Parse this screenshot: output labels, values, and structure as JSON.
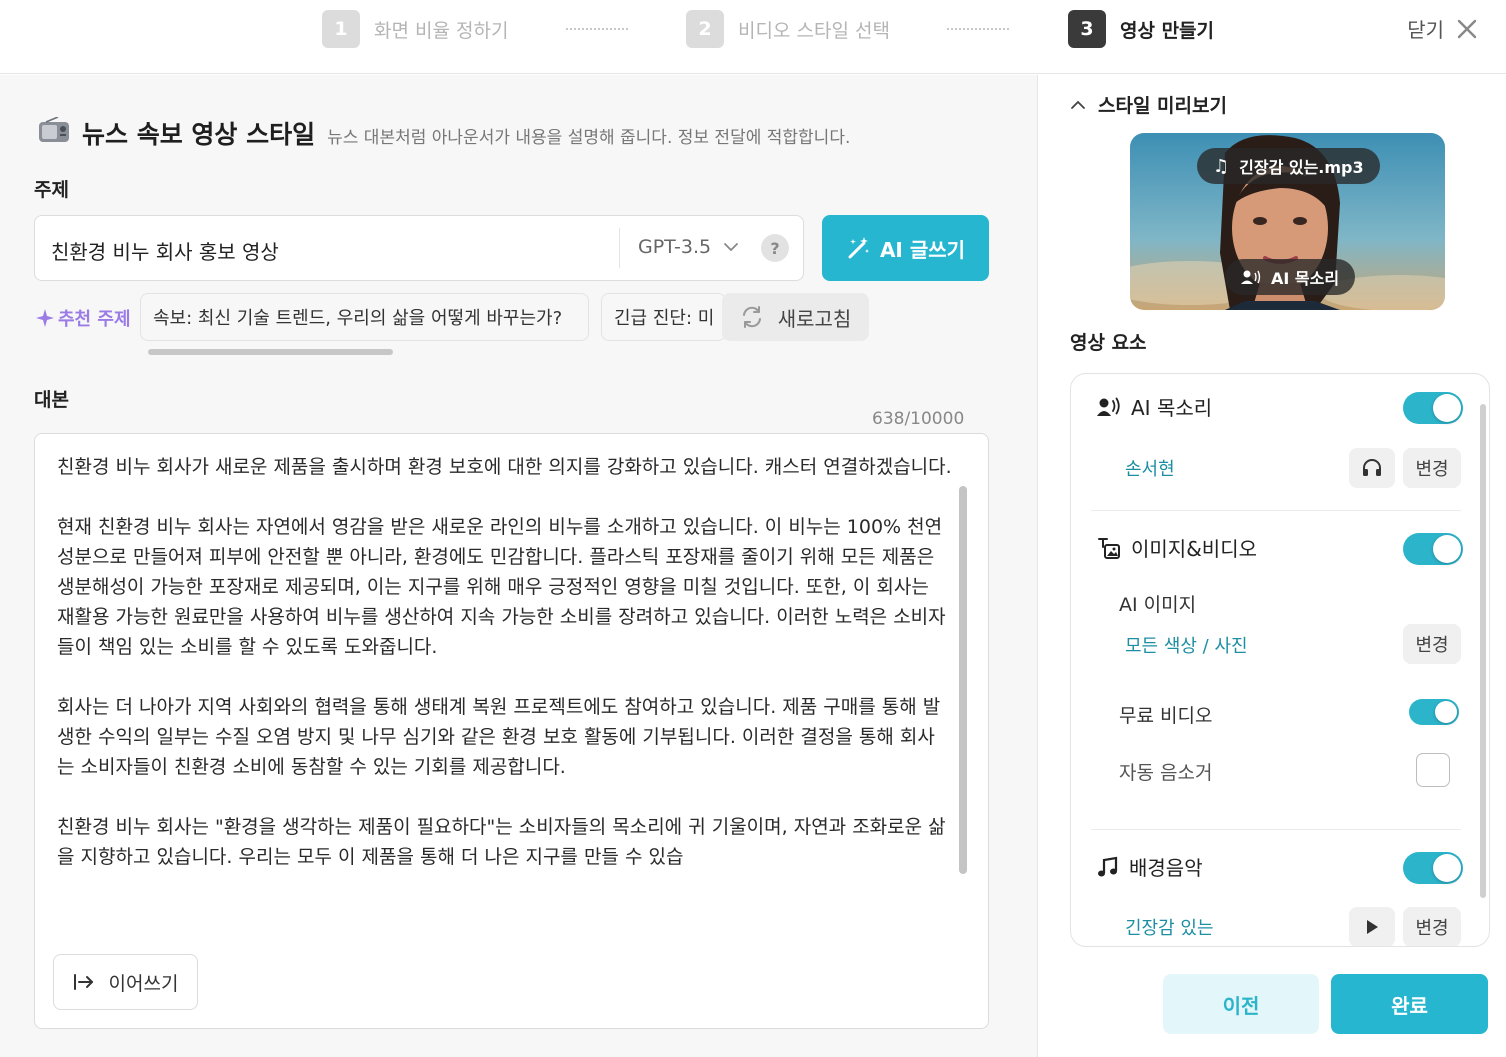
{
  "stepper": {
    "steps": [
      {
        "num": "1",
        "label": "화면 비율 정하기"
      },
      {
        "num": "2",
        "label": "비디오 스타일 선택"
      },
      {
        "num": "3",
        "label": "영상 만들기"
      }
    ],
    "close_label": "닫기",
    "active_step": 3
  },
  "style": {
    "title": "뉴스 속보 영상 스타일",
    "description": "뉴스 대본처럼 아나운서가 내용을 설명해 줍니다. 정보 전달에 적합합니다.",
    "icon": "radio-icon"
  },
  "topic": {
    "label": "주제",
    "value": "친환경 비누 회사 홍보 영상",
    "model": "GPT-3.5",
    "help": "?",
    "ai_write_label": "AI 글쓰기"
  },
  "recommend": {
    "label": "추천 주제",
    "chips": [
      "속보: 최신 기술 트렌드, 우리의 삶을 어떻게 바꾸는가?",
      "긴급 진단: 미"
    ],
    "refresh_label": "새로고침"
  },
  "script": {
    "label": "대본",
    "counter": "638/10000",
    "paragraphs": [
      "친환경 비누 회사가 새로운 제품을 출시하며 환경 보호에 대한 의지를 강화하고 있습니다. 캐스터 연결하겠습니다.",
      "현재 친환경 비누 회사는 자연에서 영감을 받은 새로운 라인의 비누를 소개하고 있습니다. 이 비누는 100% 천연 성분으로 만들어져 피부에 안전할 뿐 아니라, 환경에도 민감합니다. 플라스틱 포장재를 줄이기 위해 모든 제품은 생분해성이 가능한 포장재로 제공되며, 이는 지구를 위해 매우 긍정적인 영향을 미칠 것입니다. 또한, 이 회사는 재활용 가능한 원료만을 사용하여 비누를 생산하여 지속 가능한 소비를 장려하고 있습니다. 이러한 노력은 소비자들이 책임 있는 소비를 할 수 있도록 도와줍니다.",
      "회사는 더 나아가 지역 사회와의 협력을 통해 생태계 복원 프로젝트에도 참여하고 있습니다. 제품 구매를 통해 발생한 수익의 일부는 수질 오염 방지 및 나무 심기와 같은 환경 보호 활동에 기부됩니다. 이러한 결정을 통해 회사는 소비자들이 친환경 소비에 동참할 수 있는 기회를 제공합니다.",
      "친환경 비누 회사는 \"환경을 생각하는 제품이 필요하다\"는 소비자들의 목소리에 귀 기울이며, 자연과 조화로운 삶을 지향하고 있습니다. 우리는 모두 이 제품을 통해 더 나은 지구를 만들 수 있습"
    ],
    "continue_label": "이어쓰기"
  },
  "preview": {
    "title": "스타일 미리보기",
    "music_pill": "긴장감 있는.mp3",
    "voice_pill": "AI 목소리"
  },
  "elements": {
    "label": "영상 요소",
    "voice": {
      "title": "AI 목소리",
      "enabled": true,
      "value": "손서현",
      "change_label": "변경"
    },
    "media": {
      "title": "이미지&비디오",
      "enabled": true,
      "ai_image_label": "AI 이미지",
      "ai_image_value": "모든 색상 / 사진",
      "change_label": "변경",
      "free_video_label": "무료 비디오",
      "free_video_enabled": true,
      "auto_mute_label": "자동 음소거",
      "auto_mute_checked": false
    },
    "music": {
      "title": "배경음악",
      "enabled": true,
      "value": "긴장감 있는",
      "change_label": "변경"
    }
  },
  "footer": {
    "prev_label": "이전",
    "done_label": "완료"
  },
  "colors": {
    "accent": "#26b6cf",
    "accent_light": "#e3f6f9",
    "link": "#1e8fa3",
    "recommend": "#9b7be6"
  }
}
